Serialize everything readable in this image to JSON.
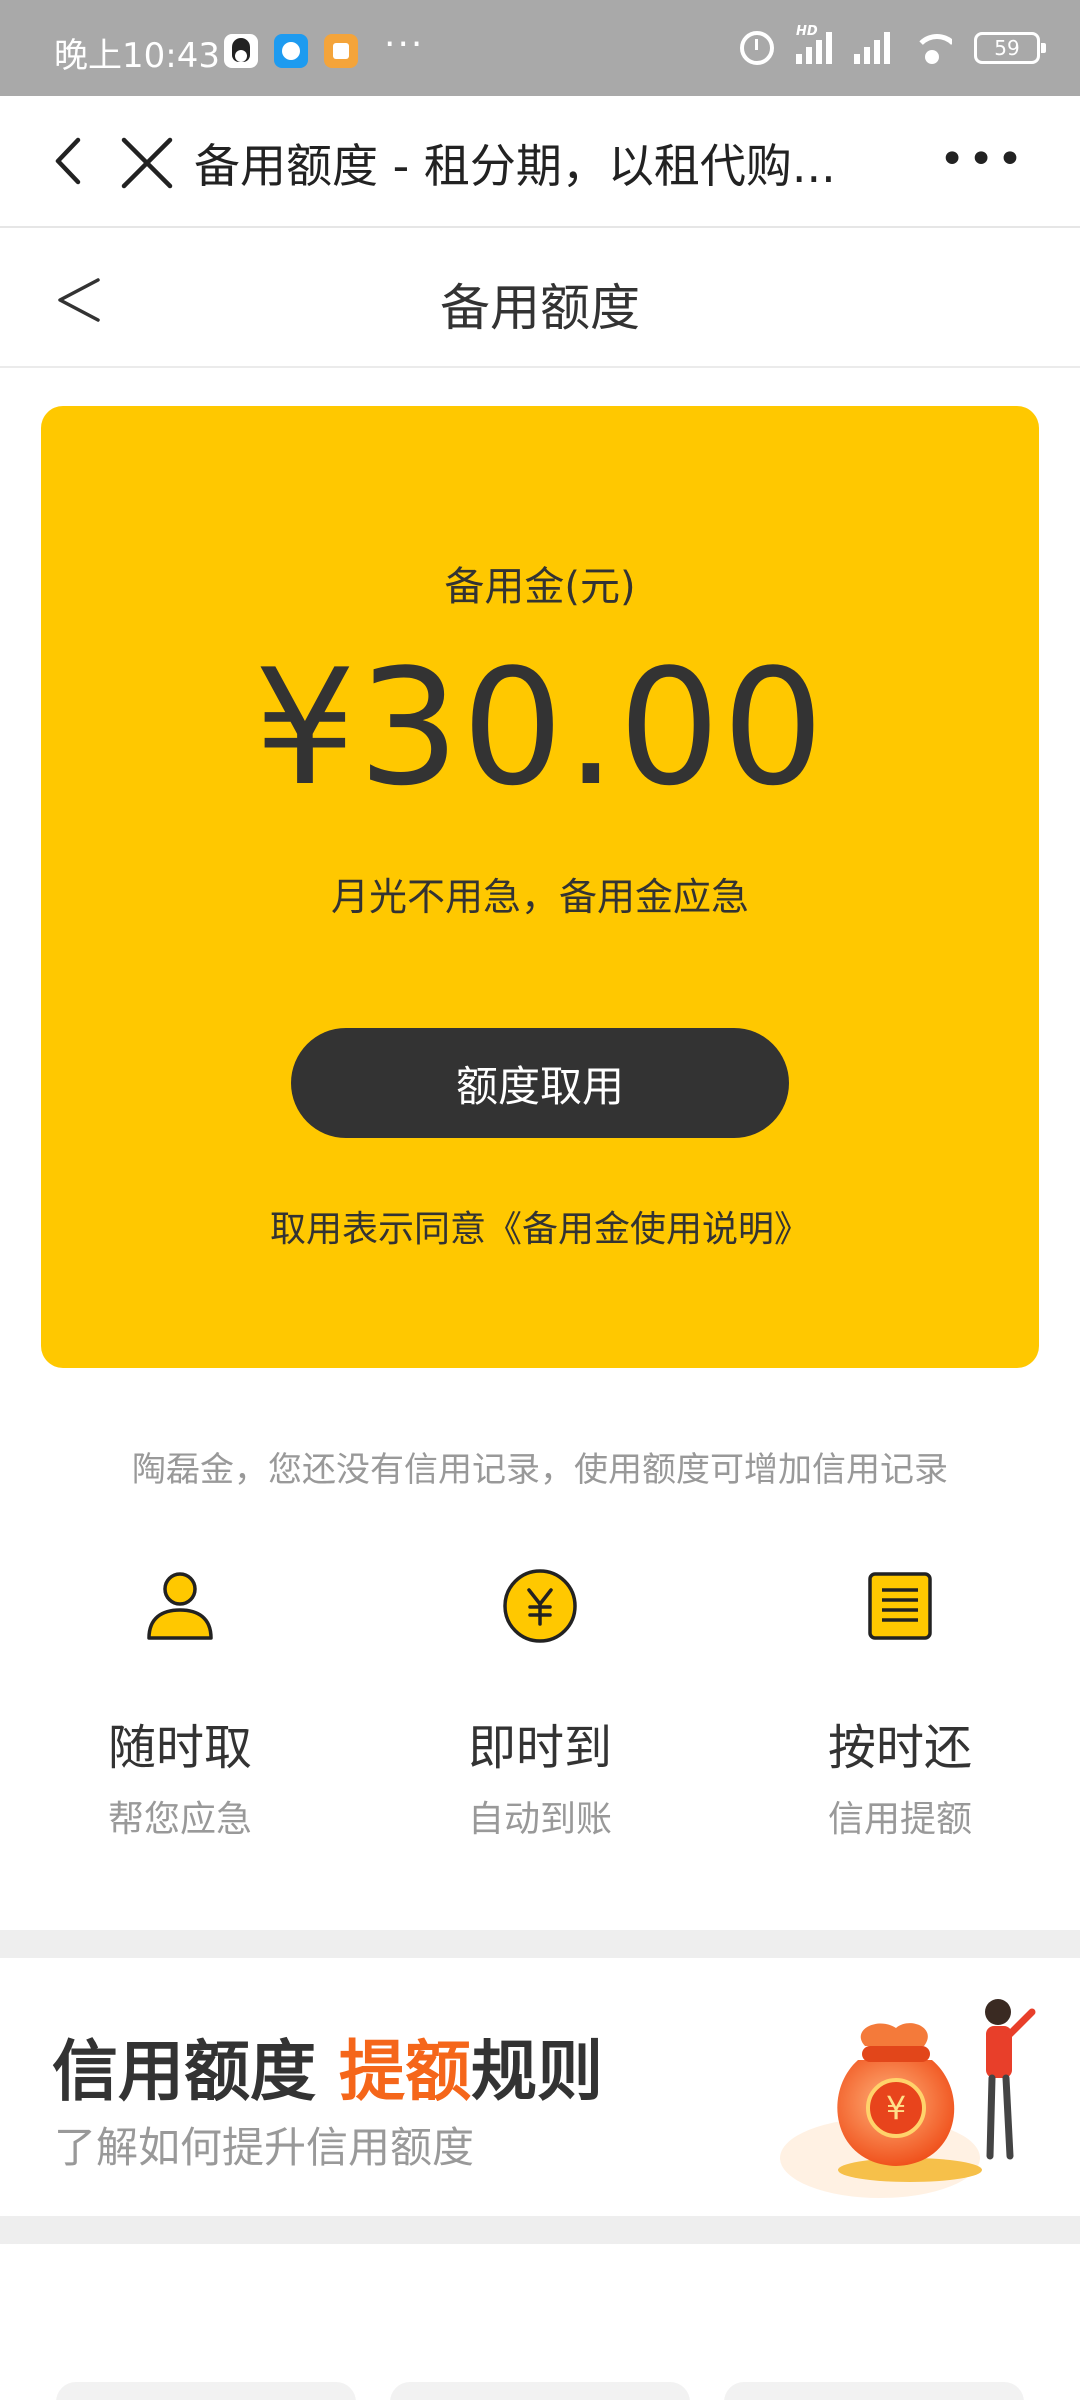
{
  "status_bar": {
    "time": "晚上10:43",
    "more": "···",
    "battery": "59",
    "hd_label": "HD"
  },
  "web_header": {
    "title": "备用额度 - 租分期，以租代购..."
  },
  "page_header": {
    "title": "备用额度"
  },
  "card": {
    "label": "备用金(元)",
    "amount": "¥30.00",
    "slogan": "月光不用急，备用金应急",
    "button_label": "额度取用",
    "agreement": "取用表示同意《备用金使用说明》"
  },
  "credit_note": "陶磊金，您还没有信用记录，使用额度可增加信用记录",
  "features": [
    {
      "title": "随时取",
      "subtitle": "帮您应急",
      "icon": "user-icon"
    },
    {
      "title": "即时到",
      "subtitle": "自动到账",
      "icon": "yuan-coin-icon"
    },
    {
      "title": "按时还",
      "subtitle": "信用提额",
      "icon": "document-icon"
    }
  ],
  "rules_banner": {
    "title_part1": "信用额度 ",
    "title_highlight": "提额",
    "title_part2": "规则",
    "subtitle": "了解如何提升信用额度",
    "illustration": "money-bag-illustration"
  },
  "colors": {
    "card_yellow": "#ffc800",
    "highlight_orange": "#f5661a",
    "button_dark": "#333333"
  }
}
